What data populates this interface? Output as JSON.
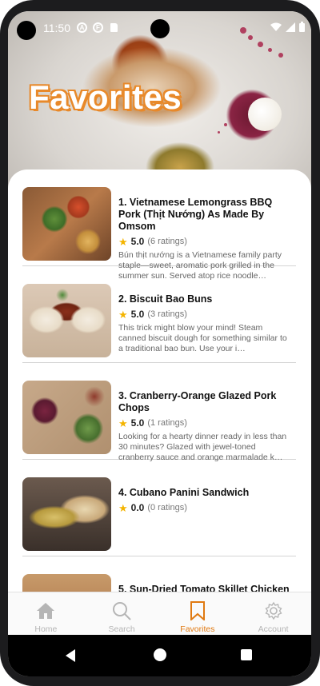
{
  "status_bar": {
    "time": "11:50",
    "icons": [
      "a-icon",
      "f-icon",
      "sd-card-icon",
      "wifi-icon",
      "signal-icon",
      "battery-icon"
    ]
  },
  "page": {
    "title": "Favorites"
  },
  "favorites": [
    {
      "title": "1. Vietnamese Lemongrass BBQ Pork (Thịt Nướng) As Made By Omsom",
      "score": "5.0",
      "ratings": "(6 ratings)",
      "description": " Bún thịt nướng is a Vietnamese family party staple—sweet, aromatic pork grilled in the summer sun. Served atop rice noodle…"
    },
    {
      "title": "2. Biscuit Bao Buns",
      "score": "5.0",
      "ratings": "(3 ratings)",
      "description": " This trick might blow your mind! Steam canned biscuit dough for something similar to a traditional bao bun. Use your i…"
    },
    {
      "title": "3. Cranberry-Orange Glazed Pork Chops",
      "score": "5.0",
      "ratings": "(1 ratings)",
      "description": " Looking for a hearty dinner ready in less than 30 minutes? Glazed with jewel-toned cranberry sauce and orange marmalade k…"
    },
    {
      "title": "4. Cubano Panini Sandwich",
      "score": "0.0",
      "ratings": "(0 ratings)",
      "description": ""
    },
    {
      "title": "5. Sun-Dried Tomato Skillet Chicken",
      "score": "",
      "ratings": "",
      "description": ""
    }
  ],
  "bottom_nav": {
    "items": [
      {
        "label": "Home",
        "icon": "home-icon"
      },
      {
        "label": "Search",
        "icon": "search-icon"
      },
      {
        "label": "Favorites",
        "icon": "bookmark-icon",
        "active": true
      },
      {
        "label": "Account",
        "icon": "gear-icon"
      }
    ]
  },
  "colors": {
    "accent": "#e07a12",
    "star": "#f4b400",
    "inactive": "#b5b5b5"
  }
}
